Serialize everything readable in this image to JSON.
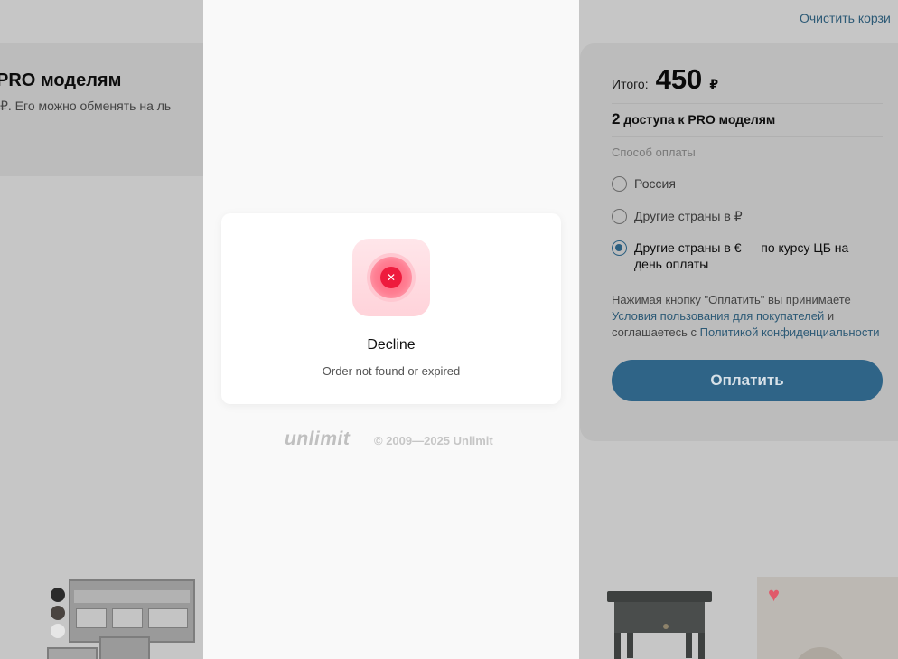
{
  "background": {
    "left_card": {
      "title": "PRO моделям",
      "text": "₽. Его можно обменять на ль"
    },
    "clear_cart": "Очистить корзи",
    "summary": {
      "total_label": "Итого:",
      "total_amount": "450",
      "currency": "₽",
      "access_count": "2",
      "access_text": "доступа к PRO моделям",
      "payment_method_label": "Способ оплаты",
      "payment_options": [
        {
          "label": "Россия",
          "checked": false
        },
        {
          "label": "Другие страны в ₽",
          "checked": false
        },
        {
          "label": "Другие страны в € — по курсу ЦБ на день оплаты",
          "checked": true
        }
      ],
      "legal_text_1": "Нажимая кнопку \"Оплатить\" вы принимаете",
      "legal_link_1": "Условия пользования для покупателей",
      "legal_text_2": "и",
      "legal_text_3": "соглашаетесь с",
      "legal_link_2": "Политикой конфиденциальности",
      "pay_button": "Оплатить"
    }
  },
  "modal": {
    "status_icon": "x-circle-icon",
    "title": "Decline",
    "message": "Order not found or expired"
  },
  "footer": {
    "brand": "unlimit",
    "copyright": "© 2009—2025 Unlimit"
  },
  "colors": {
    "accent": "#2f6487",
    "error": "#ee1b3d",
    "link": "#2d5a76"
  }
}
